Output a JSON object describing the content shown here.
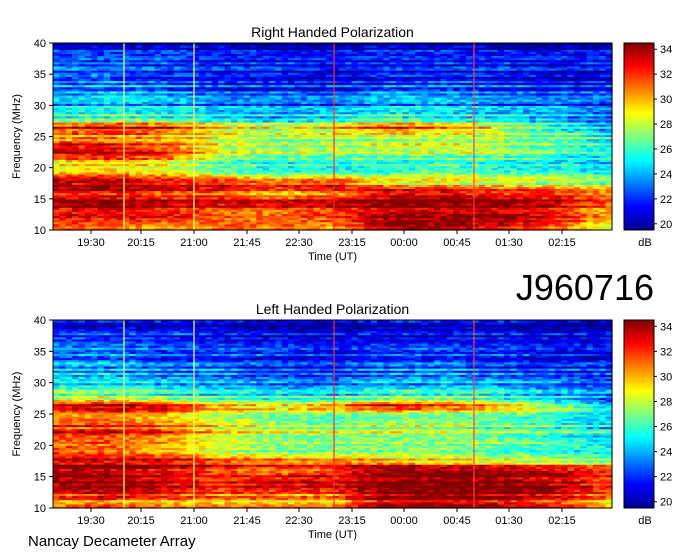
{
  "dataset_label": "J960716",
  "instrument_label": "Nancay Decameter Array",
  "colors": {
    "scale": [
      "#00008f",
      "#0000ff",
      "#0080ff",
      "#00ffff",
      "#80ff80",
      "#ffff00",
      "#ff8000",
      "#ff0000",
      "#800000"
    ]
  },
  "chart_data": [
    {
      "type": "heatmap",
      "title": "Right Handed Polarization",
      "xlabel": "Time (UT)",
      "ylabel": "Frequency (MHz)",
      "x_ticks": [
        "19:30",
        "20:15",
        "21:00",
        "21:45",
        "22:30",
        "23:15",
        "00:00",
        "00:45",
        "01:30",
        "02:15"
      ],
      "y_ticks": [
        10,
        15,
        20,
        25,
        30,
        35,
        40
      ],
      "ylim": [
        10,
        40
      ],
      "colorbar": {
        "label": "dB",
        "ticks": [
          20,
          22,
          24,
          26,
          28,
          30,
          32,
          34
        ],
        "range": [
          19.5,
          34.5
        ]
      },
      "bands": [
        {
          "f": 10.5,
          "db": [
            31,
            31,
            30,
            31,
            31,
            30,
            34,
            34,
            33,
            31,
            28
          ]
        },
        {
          "f": 12.5,
          "db": [
            33,
            33,
            33,
            31,
            31,
            32,
            34,
            34,
            34,
            33,
            30
          ]
        },
        {
          "f": 14.5,
          "db": [
            34,
            34,
            33,
            33,
            33,
            33,
            34,
            34,
            34,
            33,
            31
          ]
        },
        {
          "f": 16.0,
          "db": [
            33,
            33,
            32,
            32,
            30,
            31,
            34,
            34,
            33,
            33,
            31
          ]
        },
        {
          "f": 17.5,
          "db": [
            34,
            34,
            33,
            33,
            32,
            33,
            29,
            29,
            28,
            28,
            27
          ]
        },
        {
          "f": 19.0,
          "db": [
            31,
            31,
            30,
            28,
            27,
            27,
            27,
            28,
            27,
            27,
            26
          ]
        },
        {
          "f": 20.5,
          "db": [
            29,
            30,
            29,
            27,
            26,
            26,
            26,
            27,
            26,
            26,
            25
          ]
        },
        {
          "f": 22.0,
          "db": [
            32,
            33,
            32,
            28,
            27,
            27,
            27,
            27,
            27,
            26,
            25
          ]
        },
        {
          "f": 23.5,
          "db": [
            33,
            32,
            31,
            28,
            27,
            27,
            28,
            28,
            27,
            26,
            25
          ]
        },
        {
          "f": 25.0,
          "db": [
            29,
            30,
            29,
            28,
            27,
            27,
            27,
            27,
            27,
            26,
            25
          ]
        },
        {
          "f": 26.5,
          "db": [
            33,
            34,
            33,
            30,
            29,
            30,
            33,
            31,
            29,
            26,
            24
          ]
        },
        {
          "f": 28.0,
          "db": [
            26,
            26,
            26,
            25,
            24,
            25,
            26,
            25,
            25,
            24,
            23
          ]
        },
        {
          "f": 30.0,
          "db": [
            24,
            24,
            24,
            23,
            23,
            23,
            24,
            24,
            23,
            23,
            22
          ]
        },
        {
          "f": 32.5,
          "db": [
            23,
            24,
            23,
            22,
            22,
            22,
            23,
            23,
            22,
            22,
            22
          ]
        },
        {
          "f": 35.0,
          "db": [
            23,
            23,
            22,
            22,
            22,
            21,
            22,
            22,
            22,
            21,
            21
          ]
        },
        {
          "f": 37.5,
          "db": [
            22,
            22,
            22,
            21,
            21,
            21,
            21,
            21,
            21,
            21,
            21
          ]
        },
        {
          "f": 39.5,
          "db": [
            21,
            21,
            21,
            21,
            20,
            20,
            21,
            21,
            20,
            20,
            20
          ]
        }
      ]
    },
    {
      "type": "heatmap",
      "title": "Left Handed Polarization",
      "xlabel": "Time (UT)",
      "ylabel": "Frequency (MHz)",
      "x_ticks": [
        "19:30",
        "20:15",
        "21:00",
        "21:45",
        "22:30",
        "23:15",
        "00:00",
        "00:45",
        "01:30",
        "02:15"
      ],
      "y_ticks": [
        10,
        15,
        20,
        25,
        30,
        35,
        40
      ],
      "ylim": [
        10,
        40
      ],
      "colorbar": {
        "label": "dB",
        "ticks": [
          20,
          22,
          24,
          26,
          28,
          30,
          32,
          34
        ],
        "range": [
          19.5,
          34.5
        ]
      },
      "bands": [
        {
          "f": 10.5,
          "db": [
            30,
            31,
            30,
            30,
            30,
            30,
            34,
            34,
            33,
            32,
            29
          ]
        },
        {
          "f": 12.5,
          "db": [
            32,
            33,
            32,
            31,
            31,
            31,
            34,
            34,
            34,
            33,
            31
          ]
        },
        {
          "f": 14.5,
          "db": [
            34,
            34,
            33,
            32,
            33,
            33,
            34,
            34,
            34,
            33,
            31
          ]
        },
        {
          "f": 16.0,
          "db": [
            33,
            33,
            32,
            31,
            30,
            31,
            34,
            34,
            34,
            33,
            32
          ]
        },
        {
          "f": 17.5,
          "db": [
            34,
            34,
            34,
            33,
            32,
            32,
            31,
            30,
            29,
            29,
            28
          ]
        },
        {
          "f": 19.0,
          "db": [
            33,
            32,
            31,
            29,
            28,
            28,
            28,
            28,
            27,
            27,
            26
          ]
        },
        {
          "f": 20.5,
          "db": [
            31,
            31,
            30,
            28,
            27,
            27,
            27,
            27,
            27,
            26,
            25
          ]
        },
        {
          "f": 22.0,
          "db": [
            33,
            33,
            32,
            29,
            28,
            28,
            28,
            28,
            27,
            26,
            25
          ]
        },
        {
          "f": 23.5,
          "db": [
            32,
            32,
            31,
            29,
            28,
            27,
            28,
            28,
            27,
            26,
            25
          ]
        },
        {
          "f": 25.0,
          "db": [
            30,
            31,
            30,
            28,
            27,
            27,
            27,
            27,
            27,
            26,
            25
          ]
        },
        {
          "f": 26.5,
          "db": [
            33,
            34,
            33,
            30,
            29,
            30,
            33,
            32,
            30,
            27,
            24
          ]
        },
        {
          "f": 28.0,
          "db": [
            27,
            27,
            26,
            25,
            25,
            25,
            26,
            26,
            25,
            24,
            23
          ]
        },
        {
          "f": 30.0,
          "db": [
            25,
            25,
            24,
            24,
            23,
            23,
            24,
            24,
            24,
            23,
            22
          ]
        },
        {
          "f": 32.5,
          "db": [
            24,
            24,
            23,
            23,
            22,
            22,
            23,
            23,
            22,
            22,
            22
          ]
        },
        {
          "f": 35.0,
          "db": [
            23,
            23,
            22,
            22,
            22,
            21,
            22,
            22,
            22,
            21,
            21
          ]
        },
        {
          "f": 37.5,
          "db": [
            22,
            22,
            22,
            21,
            21,
            21,
            21,
            21,
            21,
            21,
            21
          ]
        },
        {
          "f": 39.5,
          "db": [
            21,
            21,
            21,
            21,
            20,
            20,
            21,
            21,
            21,
            20,
            20
          ]
        }
      ]
    }
  ]
}
